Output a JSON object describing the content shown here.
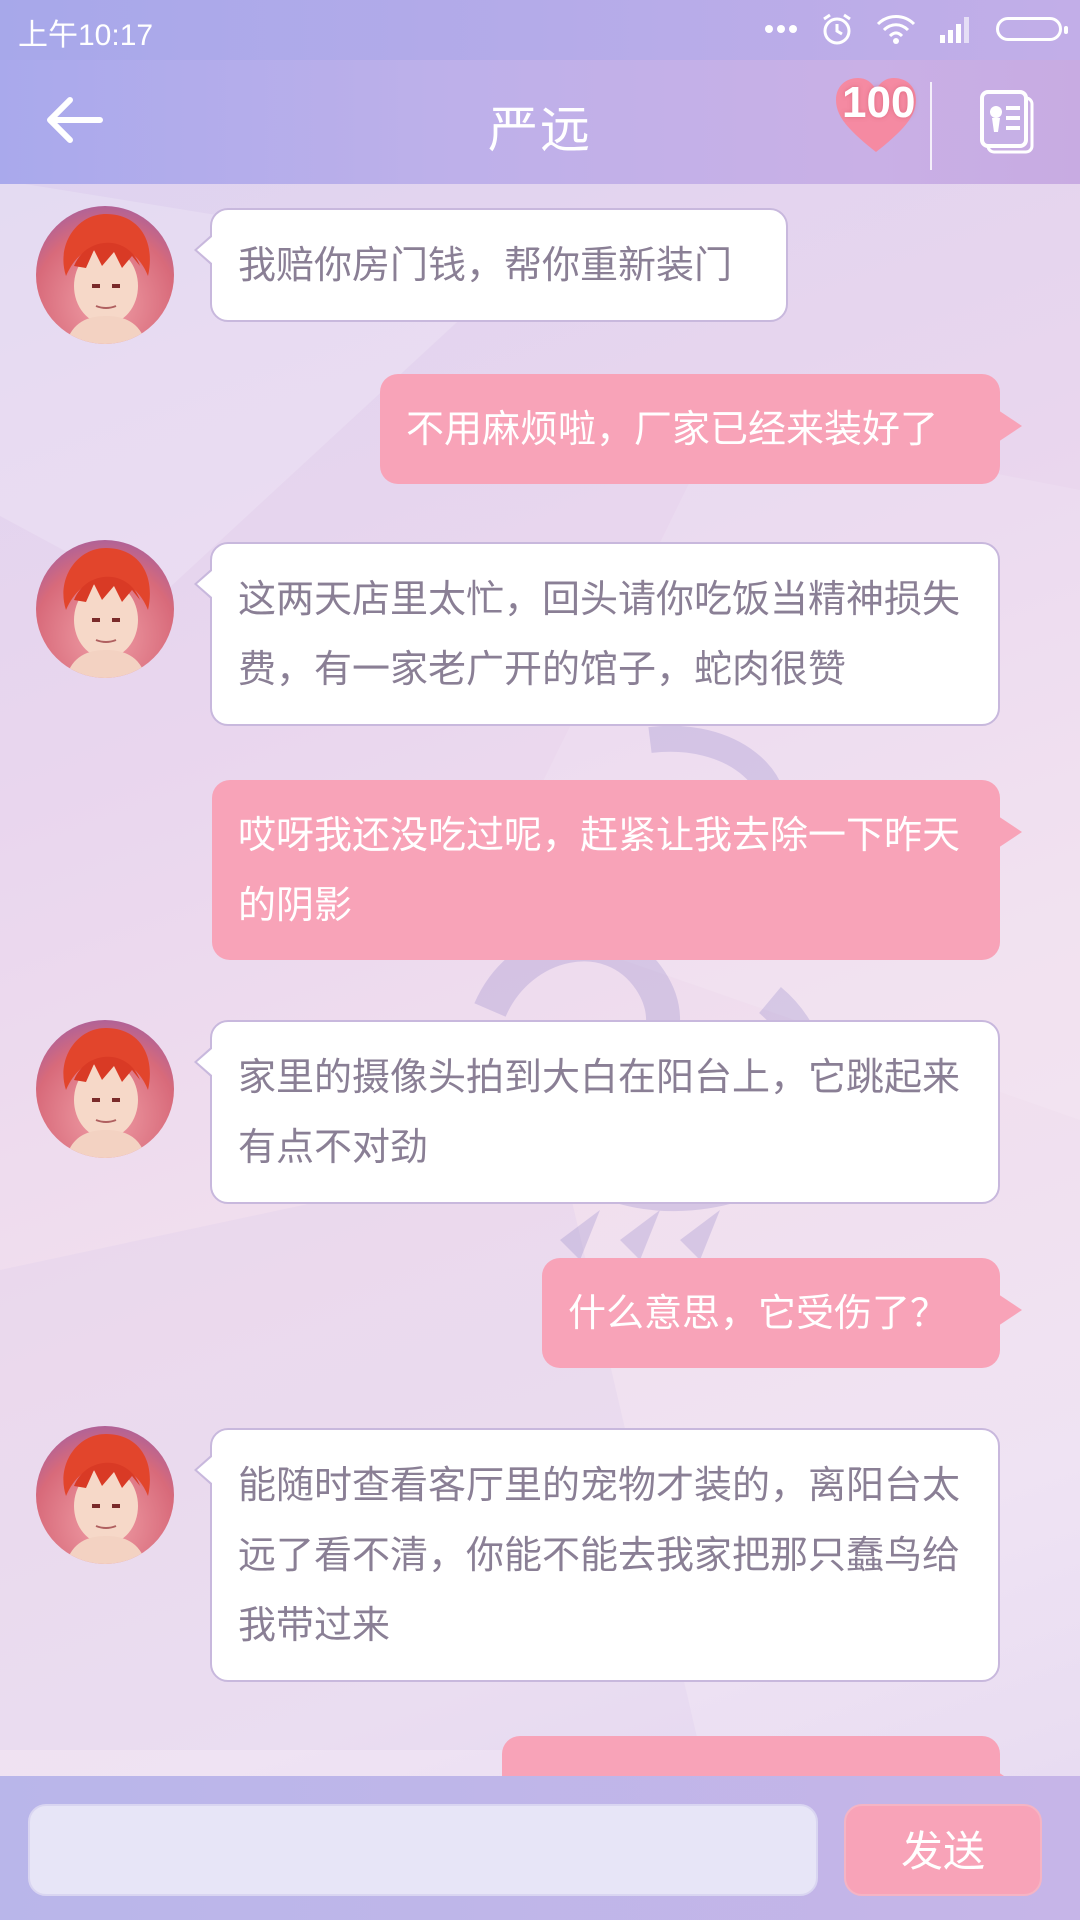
{
  "status_bar": {
    "time": "上午10:17",
    "icons": [
      "more-dots-icon",
      "alarm-icon",
      "wifi-icon",
      "signal-icon",
      "battery-icon"
    ]
  },
  "header": {
    "back_icon": "back-arrow-icon",
    "title": "严远",
    "affection": {
      "icon": "heart-icon",
      "value": "100"
    },
    "profile_icon": "contact-card-icon"
  },
  "messages": [
    {
      "side": "in",
      "text": "我赔你房门钱，帮你重新装门"
    },
    {
      "side": "out",
      "text": "不用麻烦啦，厂家已经来装好了"
    },
    {
      "side": "in",
      "text": "这两天店里太忙，回头请你吃饭当精神损失费，有一家老广开的馆子，蛇肉很赞"
    },
    {
      "side": "out",
      "text": "哎呀我还没吃过呢，赶紧让我去除一下昨天的阴影"
    },
    {
      "side": "in",
      "text": "家里的摄像头拍到大白在阳台上，它跳起来有点不对劲"
    },
    {
      "side": "out",
      "text": "什么意思，它受伤了？"
    },
    {
      "side": "in",
      "text": "能随时查看客厅里的宠物才装的，离阳台太远了看不清，你能不能去我家把那只蠢鸟给我带过来"
    },
    {
      "side": "out",
      "text": ""
    }
  ],
  "input": {
    "value": "",
    "placeholder": ""
  },
  "send_label": "发送",
  "colors": {
    "header": "#b9adea",
    "incoming_bubble": "#ffffff",
    "outgoing_bubble": "#f8a3b8",
    "incoming_text": "#8a7f95",
    "send_button": "#f8a3b8"
  }
}
